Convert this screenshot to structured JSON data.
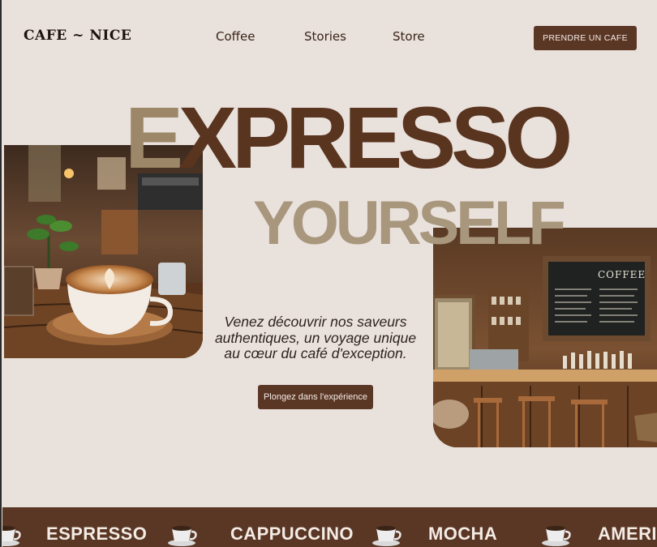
{
  "header": {
    "logo": "CAFE ~ NICE",
    "nav": [
      "Coffee",
      "Stories",
      "Store"
    ],
    "cta": "PRENDRE UN CAFE"
  },
  "hero": {
    "headline_first_letter": "E",
    "headline_rest": "XPRESSO",
    "headline_line2": "YOURSELF",
    "tagline": "Venez découvrir nos saveurs authentiques, un voyage unique au cœur du café d'exception.",
    "cta": "Plongez dans l'expérience",
    "image_left": "latte-art-cup-image",
    "image_right": "cafe-interior-image",
    "menu_board_text": "COFFEE"
  },
  "ticker": {
    "items": [
      "ESPRESSO",
      "CAPPUCCINO",
      "MOCHA",
      "AMERIC"
    ],
    "icon": "coffee-cup-icon"
  },
  "colors": {
    "background": "#e9e1dc",
    "brown": "#5a3625",
    "tan": "#a8977c"
  }
}
